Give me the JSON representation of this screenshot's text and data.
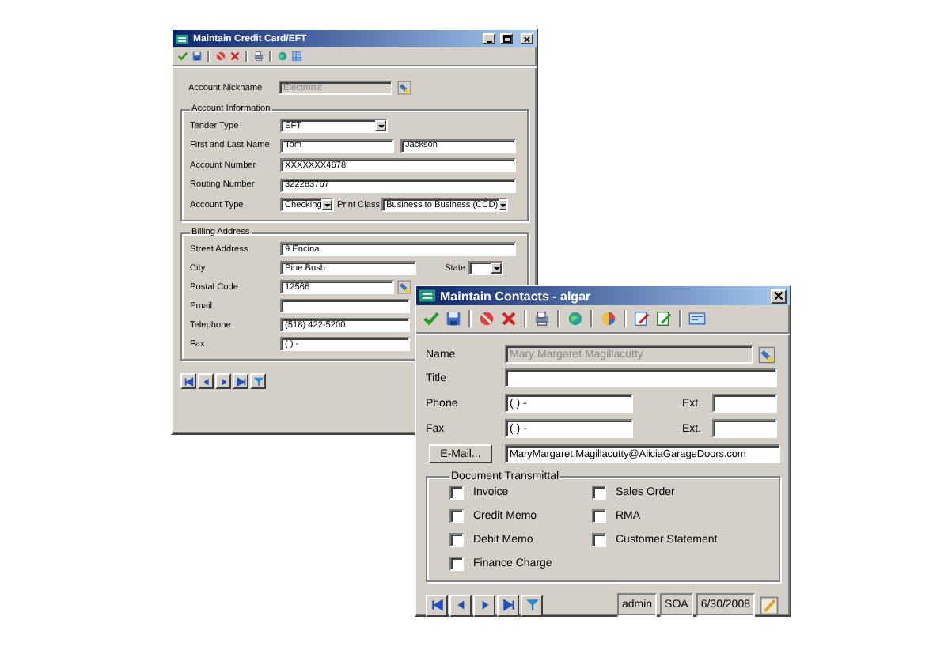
{
  "credit_card_window": {
    "title": "Maintain Credit Card/EFT",
    "account_nickname": {
      "label": "Account Nickname",
      "value": "Electronic",
      "disabled": true
    },
    "account_information": {
      "title": "Account Information",
      "rows": [
        {
          "kind": "select",
          "label": "Tender Type",
          "value": "EFT"
        },
        {
          "kind": "pair",
          "label": "First and Last Name",
          "value": "Tom",
          "value_2": "Jackson"
        },
        {
          "kind": "text",
          "label": "Account Number",
          "value": "XXXXXXX4678"
        },
        {
          "kind": "text",
          "label": "Routing Number",
          "value": "322283767"
        },
        {
          "kind": "selects",
          "label": "Account Type",
          "value": "Checking",
          "label_2": "Print Class",
          "value_2": "Business to Business (CCD)"
        }
      ]
    },
    "billing_address": {
      "title": "Billing Address",
      "rows": [
        {
          "kind": "text",
          "label": "Street Address",
          "value": "9 Encina"
        },
        {
          "kind": "city",
          "label": "City",
          "value": "Pine Bush",
          "label_2": "State"
        },
        {
          "kind": "lookup",
          "label": "Postal Code",
          "value": "12566"
        },
        {
          "kind": "partial",
          "label": "Email"
        },
        {
          "kind": "partial",
          "label": "Telephone",
          "value": "(518) 422-5200"
        },
        {
          "kind": "partial",
          "label": "Fax",
          "value": "(  )   -"
        }
      ]
    }
  },
  "contacts_window": {
    "title": "Maintain Contacts - algar",
    "rows": [
      {
        "kind": "lookup",
        "label": "Name",
        "value": "Mary Margaret Magillacutty",
        "disabled": true
      },
      {
        "kind": "text",
        "label": "Title"
      },
      {
        "kind": "ext",
        "label": "Phone",
        "value": "(  )   -",
        "label_2": "Ext."
      },
      {
        "kind": "ext",
        "label": "Fax",
        "value": "(  )   -",
        "label_2": "Ext."
      },
      {
        "kind": "button",
        "label": "E-Mail...",
        "value": "MaryMargaret.Magillacutty@AliciaGarageDoors.com"
      }
    ],
    "document_transmittal": {
      "title": "Document Transmittal",
      "options": [
        {
          "label": "Invoice",
          "checked": false
        },
        {
          "label": "Sales Order",
          "checked": false
        },
        {
          "label": "Credit Memo",
          "checked": false
        },
        {
          "label": "RMA",
          "checked": false
        },
        {
          "label": "Debit Memo",
          "checked": false
        },
        {
          "label": "Customer Statement",
          "checked": false
        },
        {
          "label": "Finance Charge",
          "checked": false
        }
      ]
    },
    "status_bar": [
      "admin",
      "SOA",
      "6/30/2008"
    ]
  }
}
